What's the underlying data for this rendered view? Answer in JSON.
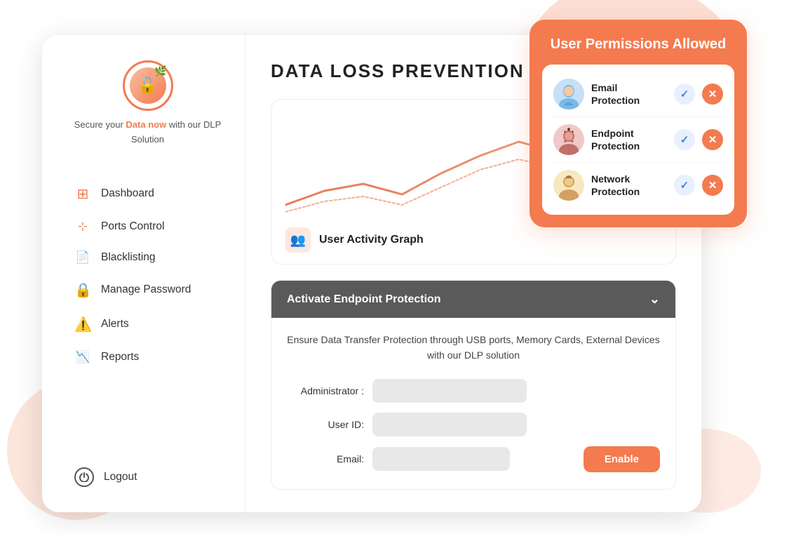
{
  "blobs": {},
  "sidebar": {
    "tagline_prefix": "Secure your ",
    "tagline_highlight": "Data now",
    "tagline_suffix": " with our DLP Solution",
    "nav_items": [
      {
        "id": "dashboard",
        "label": "Dashboard",
        "icon": "⊞"
      },
      {
        "id": "ports-control",
        "label": "Ports Control",
        "icon": "⊹"
      },
      {
        "id": "blacklisting",
        "label": "Blacklisting",
        "icon": "🗒"
      },
      {
        "id": "manage-password",
        "label": "Manage Password",
        "icon": "🔒"
      },
      {
        "id": "alerts",
        "label": "Alerts",
        "icon": "⚠"
      },
      {
        "id": "reports",
        "label": "Reports",
        "icon": "📉"
      }
    ],
    "logout_label": "Logout"
  },
  "main": {
    "title": "DATA LOSS PREVENTION",
    "graph": {
      "label": "User Activity Graph",
      "icon": "👥"
    },
    "accordion": {
      "header": "Activate  Endpoint Protection",
      "description": "Ensure Data Transfer Protection through USB ports, Memory Cards, External Devices with our DLP solution",
      "fields": [
        {
          "id": "administrator",
          "label": "Administrator :",
          "placeholder": ""
        },
        {
          "id": "user-id",
          "label": "User ID:",
          "placeholder": ""
        },
        {
          "id": "email",
          "label": "Email:",
          "placeholder": ""
        }
      ],
      "enable_button": "Enable"
    }
  },
  "permissions": {
    "title": "User Permissions Allowed",
    "rows": [
      {
        "id": "email-protection",
        "name": "Email Protection",
        "avatar": "👤",
        "avatar_class": "avatar-1"
      },
      {
        "id": "endpoint-protection",
        "name": "Endpoint Protection",
        "avatar": "🧔",
        "avatar_class": "avatar-2"
      },
      {
        "id": "network-protection",
        "name": "Network Protection",
        "avatar": "👱",
        "avatar_class": "avatar-3"
      }
    ],
    "check_label": "✓",
    "x_label": "✕"
  }
}
